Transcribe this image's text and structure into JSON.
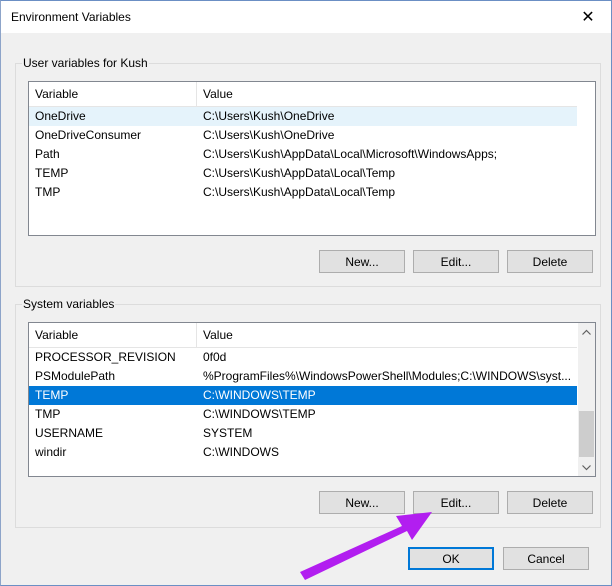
{
  "window": {
    "title": "Environment Variables",
    "close_glyph": "✕"
  },
  "user_vars": {
    "group_label": "User variables for Kush",
    "columns": [
      "Variable",
      "Value"
    ],
    "rows": [
      {
        "variable": "OneDrive",
        "value": "C:\\Users\\Kush\\OneDrive"
      },
      {
        "variable": "OneDriveConsumer",
        "value": "C:\\Users\\Kush\\OneDrive"
      },
      {
        "variable": "Path",
        "value": "C:\\Users\\Kush\\AppData\\Local\\Microsoft\\WindowsApps;"
      },
      {
        "variable": "TEMP",
        "value": "C:\\Users\\Kush\\AppData\\Local\\Temp"
      },
      {
        "variable": "TMP",
        "value": "C:\\Users\\Kush\\AppData\\Local\\Temp"
      }
    ],
    "buttons": {
      "new": "New...",
      "edit": "Edit...",
      "delete": "Delete"
    }
  },
  "system_vars": {
    "group_label": "System variables",
    "columns": [
      "Variable",
      "Value"
    ],
    "rows": [
      {
        "variable": "PROCESSOR_REVISION",
        "value": "0f0d"
      },
      {
        "variable": "PSModulePath",
        "value": "%ProgramFiles%\\WindowsPowerShell\\Modules;C:\\WINDOWS\\syst..."
      },
      {
        "variable": "TEMP",
        "value": "C:\\WINDOWS\\TEMP"
      },
      {
        "variable": "TMP",
        "value": "C:\\WINDOWS\\TEMP"
      },
      {
        "variable": "USERNAME",
        "value": "SYSTEM"
      },
      {
        "variable": "windir",
        "value": "C:\\WINDOWS"
      }
    ],
    "selected_row": "TEMP",
    "buttons": {
      "new": "New...",
      "edit": "Edit...",
      "delete": "Delete"
    }
  },
  "dialog_buttons": {
    "ok": "OK",
    "cancel": "Cancel"
  },
  "annotation": {
    "arrow_color": "#b21ef0",
    "points_to": "Edit..."
  },
  "colors": {
    "selection": "#0078d7",
    "hover": "#e5f3fb",
    "default_button_border": "#0078d7"
  },
  "icons": {
    "close": "close-icon",
    "scroll_up": "chevron-up-icon",
    "scroll_down": "chevron-down-icon"
  }
}
